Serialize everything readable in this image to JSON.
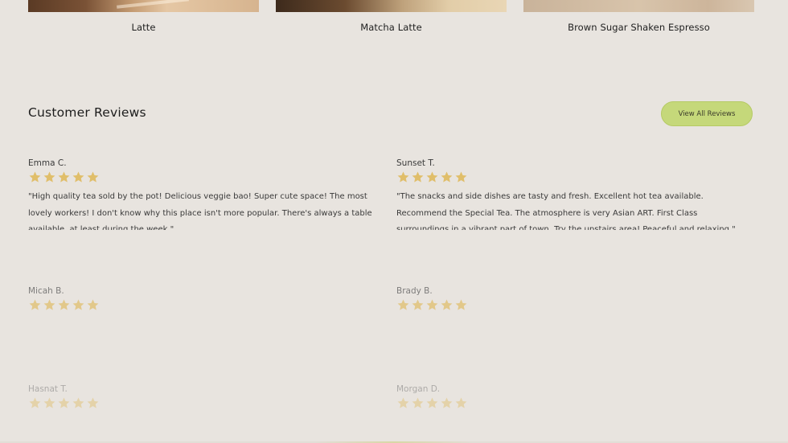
{
  "products": [
    {
      "name": "Latte"
    },
    {
      "name": "Matcha Latte"
    },
    {
      "name": "Brown Sugar Shaken Espresso"
    }
  ],
  "reviews_section": {
    "title": "Customer Reviews",
    "view_all_label": "View All Reviews"
  },
  "colors": {
    "background": "#e8e4df",
    "accent_button": "#c5d87a",
    "star": "#e0be6a"
  },
  "reviews": [
    {
      "author": "Emma C.",
      "rating": 5,
      "text": "\"High quality tea sold by the pot! Delicious veggie bao! Super cute space! The most lovely workers! I don't know why this place isn't more popular. There's always a table available, at least during the week.\""
    },
    {
      "author": "Sunset T.",
      "rating": 5,
      "text": "\"The snacks and side dishes are tasty and fresh. Excellent hot tea available. Recommend the Special Tea. The atmosphere is very Asian ART. First Class surroundings in a vibrant part of town. Try the upstairs area! Peaceful and relaxing.\""
    },
    {
      "author": "Micah B.",
      "rating": 5,
      "text": ""
    },
    {
      "author": "Brady B.",
      "rating": 5,
      "text": ""
    },
    {
      "author": "Hasnat T.",
      "rating": 5,
      "text": ""
    },
    {
      "author": "Morgan D.",
      "rating": 5,
      "text": ""
    }
  ]
}
